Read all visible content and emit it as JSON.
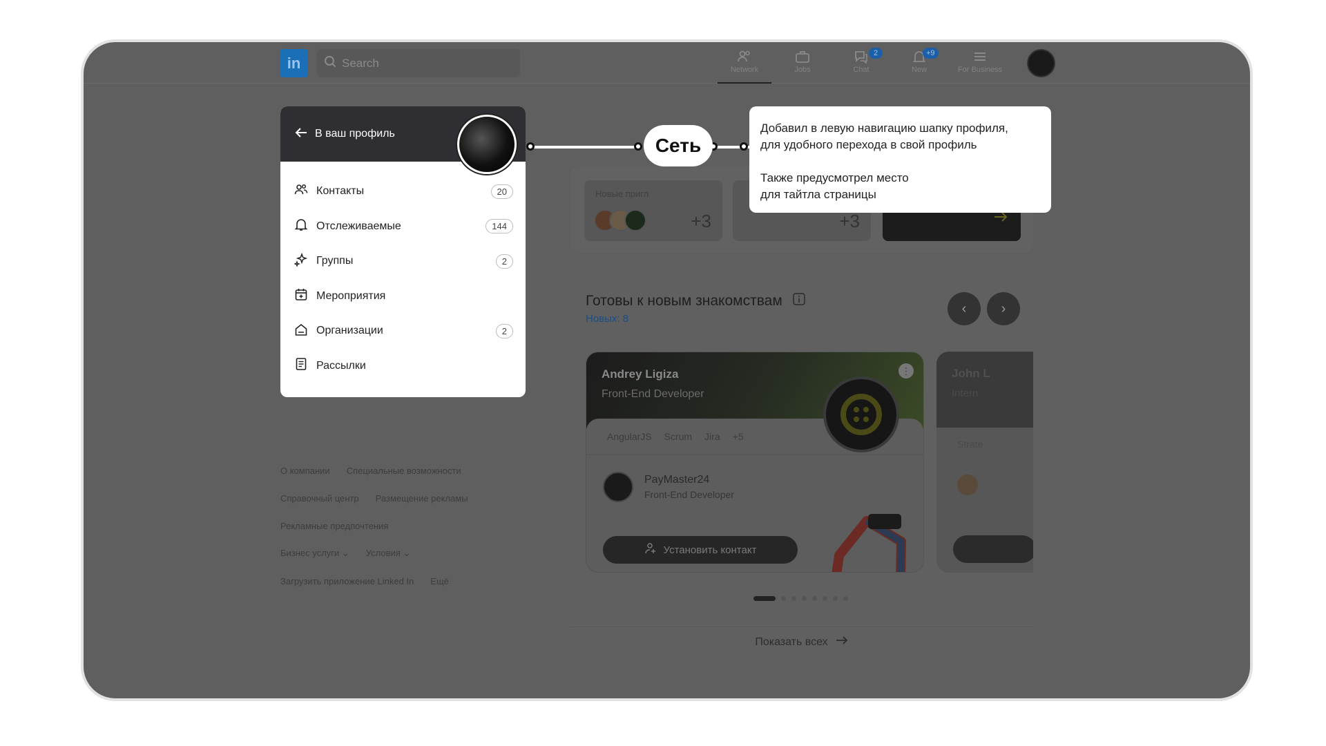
{
  "topbar": {
    "logo": "in",
    "search_placeholder": "Search",
    "nav": [
      {
        "label": "Network",
        "icon": "people-icon",
        "badge": ""
      },
      {
        "label": "Jobs",
        "icon": "briefcase-icon",
        "badge": ""
      },
      {
        "label": "Chat",
        "icon": "chat-icon",
        "badge": "2"
      },
      {
        "label": "New",
        "icon": "bell-icon",
        "badge": "+9"
      },
      {
        "label": "For Business",
        "icon": "menu-icon",
        "badge": ""
      }
    ]
  },
  "sidebar": {
    "back_label": "В ваш профиль",
    "items": [
      {
        "label": "Контакты",
        "count": "20",
        "icon": "contacts-icon"
      },
      {
        "label": "Отслеживаемые",
        "count": "144",
        "icon": "bell-icon"
      },
      {
        "label": "Группы",
        "count": "2",
        "icon": "sparkle-icon"
      },
      {
        "label": "Мероприятия",
        "count": "",
        "icon": "calendar-icon"
      },
      {
        "label": "Организации",
        "count": "2",
        "icon": "building-icon"
      },
      {
        "label": "Рассылки",
        "count": "",
        "icon": "newsletter-icon"
      }
    ]
  },
  "footer_links": {
    "about": "О компании",
    "accessibility": "Специальные возможности",
    "help": "Справочный центр",
    "ads": "Размещение рекламы",
    "ad_prefs": "Рекламные предпочтения",
    "business": "Бизнес услуги",
    "terms": "Условия",
    "app": "Загрузить приложение Linked In",
    "more": "Ещё"
  },
  "invites": {
    "label": "Новые пригл",
    "count1": "+3",
    "count2": "+3"
  },
  "suggestions": {
    "title": "Готовы к новым знакомствам",
    "new_count": "Новых: 8",
    "card": {
      "name": "Andrey Ligiza",
      "role": "Front-End Developer",
      "tags": [
        "AngularJS",
        "Scrum",
        "Jira",
        "+5"
      ],
      "company": "PayMaster24",
      "company_role": "Front-End Developer",
      "connect": "Установить контакт"
    },
    "card2": {
      "name": "John L",
      "role": "Intern",
      "tag": "Strate"
    },
    "show_all": "Показать всех"
  },
  "annotation": {
    "pill": "Сеть",
    "line1": "Добавил в левую навигацию шапку профиля,",
    "line2": "для удобного перехода в свой профиль",
    "line3": "Также предусмотрел место",
    "line4": "для тайтла страницы"
  },
  "colors": {
    "overlay": "#5f5f5f",
    "brand": "#1a6fb6",
    "badge": "#1b5fa8",
    "link": "#1a4e86"
  }
}
